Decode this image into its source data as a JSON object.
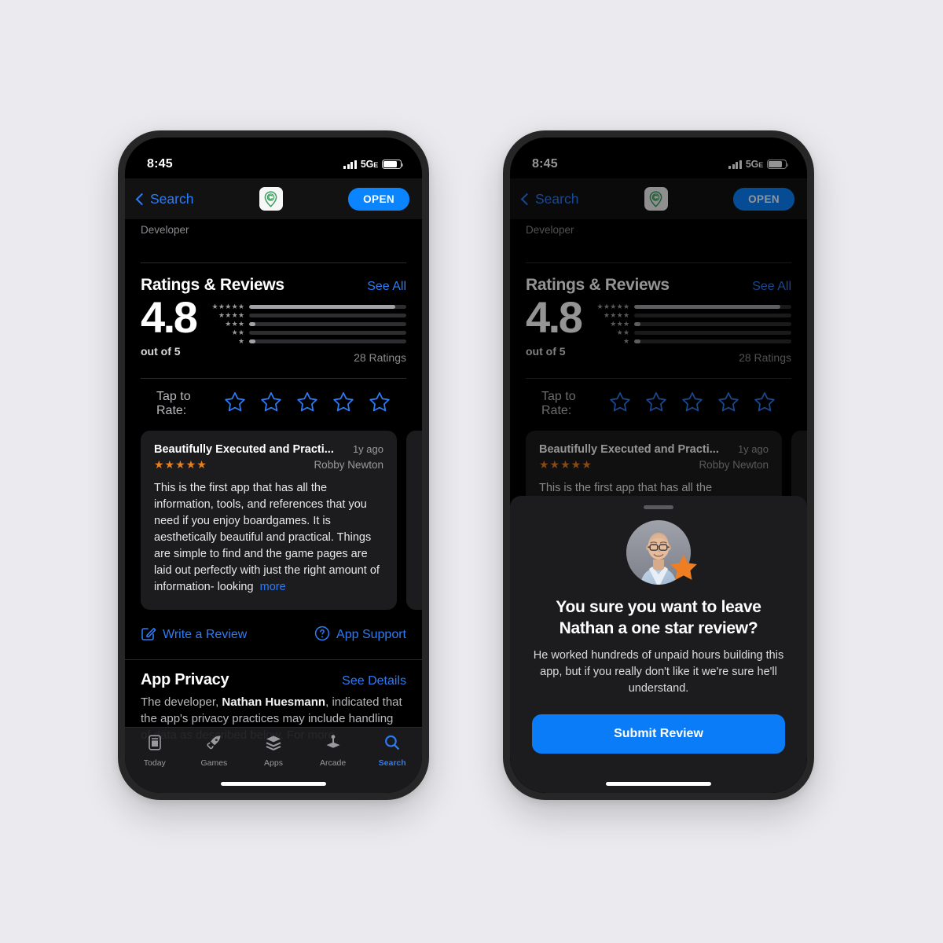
{
  "background_color": "#ebebef",
  "accent_color": "#0a84ff",
  "star_color": "#e98020",
  "status_bar": {
    "time": "8:45",
    "network": "5G",
    "network_suffix": "E"
  },
  "nav": {
    "back_label": "Search",
    "app_icon_name": "map-pin-c-icon",
    "open_label": "OPEN"
  },
  "content": {
    "developer_label": "Developer",
    "ratings_section": {
      "title": "Ratings & Reviews",
      "see_all_label": "See All",
      "score": "4.8",
      "out_of_label": "out of 5",
      "count_label": "28 Ratings",
      "histogram": [
        {
          "stars": "★★★★★",
          "percent": 93
        },
        {
          "stars": "★★★★",
          "percent": 0
        },
        {
          "stars": "★★★",
          "percent": 4
        },
        {
          "stars": "★★",
          "percent": 0
        },
        {
          "stars": "★",
          "percent": 4
        }
      ]
    },
    "tap_to_rate": {
      "label": "Tap to Rate:",
      "star_count": 5,
      "selected": 0
    },
    "reviews": [
      {
        "title": "Beautifully Executed and Practi...",
        "age": "1y ago",
        "stars": "★★★★★",
        "author": "Robby Newton",
        "body": "This is the first app that has all the information, tools, and references that you need if you enjoy boardgames. It is aesthetically beautiful and practical. Things are simple to find and the game pages are laid out perfectly with just the right amount of information- looking",
        "more_label": "more"
      }
    ],
    "actions": {
      "write_review_label": "Write a Review",
      "write_review_icon": "compose-icon",
      "app_support_label": "App Support",
      "app_support_icon": "question-circle-icon"
    },
    "privacy": {
      "title": "App Privacy",
      "see_details_label": "See Details",
      "body_prefix": "The developer, ",
      "developer_name": "Nathan Huesmann",
      "body_suffix": ", indicated that the app's privacy practices may include handling of data as described below. For more"
    }
  },
  "tabbar": {
    "items": [
      {
        "label": "Today",
        "icon": "today-icon",
        "active": false
      },
      {
        "label": "Games",
        "icon": "rocket-icon",
        "active": false
      },
      {
        "label": "Apps",
        "icon": "stack-icon",
        "active": false
      },
      {
        "label": "Arcade",
        "icon": "joystick-icon",
        "active": false
      },
      {
        "label": "Search",
        "icon": "search-icon",
        "active": true
      }
    ]
  },
  "sheet": {
    "avatar_name": "developer-avatar",
    "badge_icon": "orange-star-icon",
    "title": "You sure you want to leave Nathan a one star review?",
    "body": "He worked hundreds of unpaid hours building this app, but if you really don't like it we're sure he'll understand.",
    "submit_label": "Submit Review"
  }
}
